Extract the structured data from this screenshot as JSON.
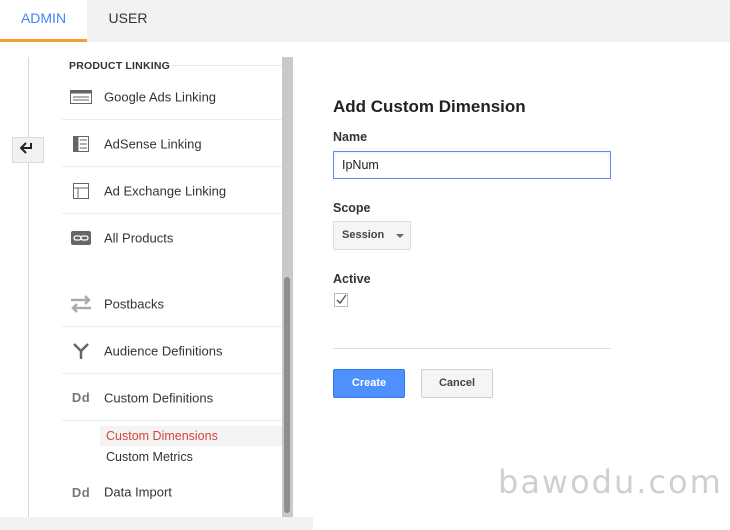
{
  "tabs": [
    {
      "label": "ADMIN",
      "active": true
    },
    {
      "label": "USER",
      "active": false
    }
  ],
  "colors": {
    "accent_blue": "#4285f4",
    "tab_underline": "#f4a033",
    "active_link_red": "#d44638",
    "primary_button": "#4d90fe"
  },
  "back_button": {
    "icon": "arrow-left-icon"
  },
  "nav": {
    "section_title": "PRODUCT LINKING",
    "items": [
      {
        "label": "Google Ads Linking",
        "icon": "google-ads-icon"
      },
      {
        "label": "AdSense Linking",
        "icon": "adsense-icon"
      },
      {
        "label": "Ad Exchange Linking",
        "icon": "ad-exchange-icon"
      },
      {
        "label": "All Products",
        "icon": "link-icon"
      },
      {
        "label": "Postbacks",
        "icon": "postbacks-icon"
      },
      {
        "label": "Audience Definitions",
        "icon": "audience-fork-icon"
      },
      {
        "label": "Custom Definitions",
        "icon": "dd-icon",
        "icon_text": "Dd"
      }
    ],
    "sub_items": [
      {
        "label": "Custom Dimensions",
        "active": true
      },
      {
        "label": "Custom Metrics",
        "active": false
      }
    ],
    "data_import": {
      "label": "Data Import",
      "icon": "dd-icon",
      "icon_text": "Dd"
    }
  },
  "form": {
    "title": "Add Custom Dimension",
    "name_label": "Name",
    "name_value": "IpNum",
    "scope_label": "Scope",
    "scope_value": "Session",
    "active_label": "Active",
    "active_checked": true,
    "create_label": "Create",
    "cancel_label": "Cancel"
  },
  "watermark": "bawodu.com"
}
